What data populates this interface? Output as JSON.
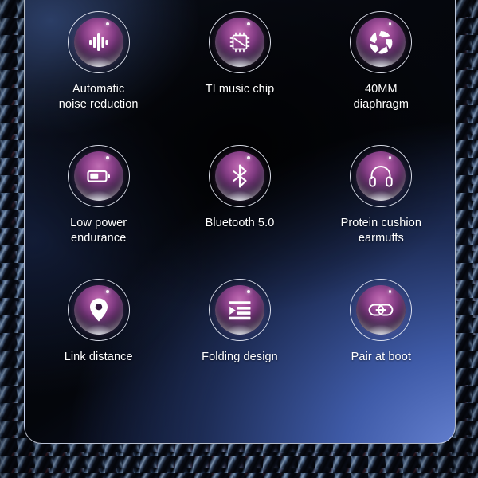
{
  "panel": {
    "background_dark": "#04060b",
    "background_blue": "#6a86d6",
    "border_color": "#e1e8f5"
  },
  "badge": {
    "accent_top": "#c06fb4",
    "accent_mid": "#7e3a80",
    "accent_dark": "#120a18",
    "ring_color": "#ecf0fa"
  },
  "features": [
    {
      "icon": "sound-wave-icon",
      "label": "Automatic\nnoise reduction"
    },
    {
      "icon": "chip-icon",
      "label": "TI music chip"
    },
    {
      "icon": "aperture-icon",
      "label": "40MM\ndiaphragm"
    },
    {
      "icon": "battery-icon",
      "label": "Low power\nendurance"
    },
    {
      "icon": "bluetooth-icon",
      "label": "Bluetooth 5.0"
    },
    {
      "icon": "headphones-icon",
      "label": "Protein cushion\nearmuffs"
    },
    {
      "icon": "map-pin-icon",
      "label": "Link distance"
    },
    {
      "icon": "fold-indent-icon",
      "label": "Folding design"
    },
    {
      "icon": "chain-link-icon",
      "label": "Pair at boot"
    }
  ]
}
